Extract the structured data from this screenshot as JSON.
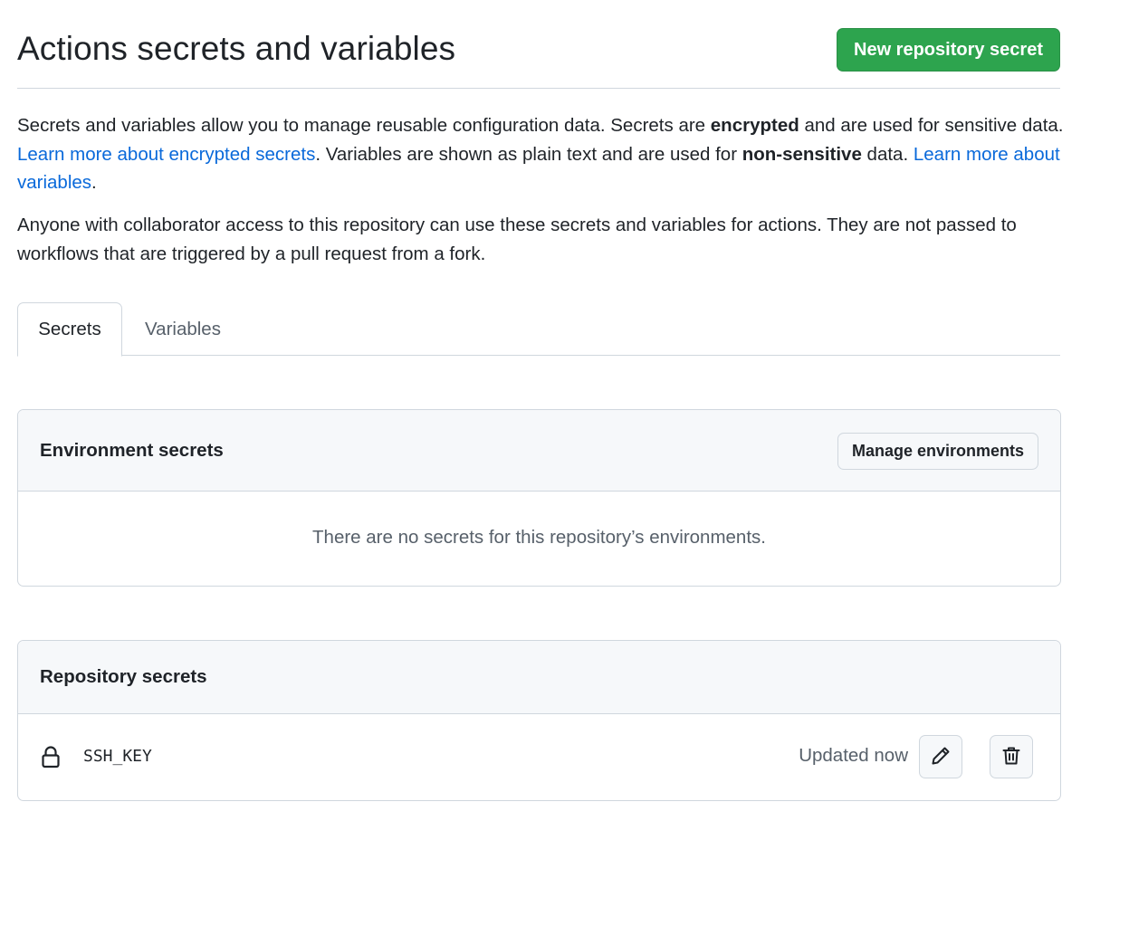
{
  "header": {
    "title": "Actions secrets and variables",
    "new_secret_button": "New repository secret"
  },
  "intro": {
    "p1_part1": "Secrets and variables allow you to manage reusable configuration data. Secrets are ",
    "p1_bold1": "encrypted",
    "p1_part2": " and are used for sensitive data. ",
    "p1_link1": "Learn more about encrypted secrets",
    "p1_part3": ". Variables are shown as plain text and are used for ",
    "p1_bold2": "non-sensitive",
    "p1_part4": " data. ",
    "p1_link2": "Learn more about variables",
    "p1_part5": ".",
    "p2": "Anyone with collaborator access to this repository can use these secrets and variables for actions. They are not passed to workflows that are triggered by a pull request from a fork."
  },
  "tabs": [
    {
      "label": "Secrets",
      "selected": true
    },
    {
      "label": "Variables",
      "selected": false
    }
  ],
  "environment_secrets": {
    "title": "Environment secrets",
    "manage_button": "Manage environments",
    "empty_message": "There are no secrets for this repository’s environments."
  },
  "repository_secrets": {
    "title": "Repository secrets",
    "items": [
      {
        "name": "SSH_KEY",
        "updated": "Updated now",
        "icon": "lock-icon"
      }
    ]
  },
  "colors": {
    "primary_button": "#2da44e",
    "link": "#0969da",
    "border": "#d0d7de",
    "muted_text": "#57606a",
    "box_header_bg": "#f6f8fa"
  }
}
